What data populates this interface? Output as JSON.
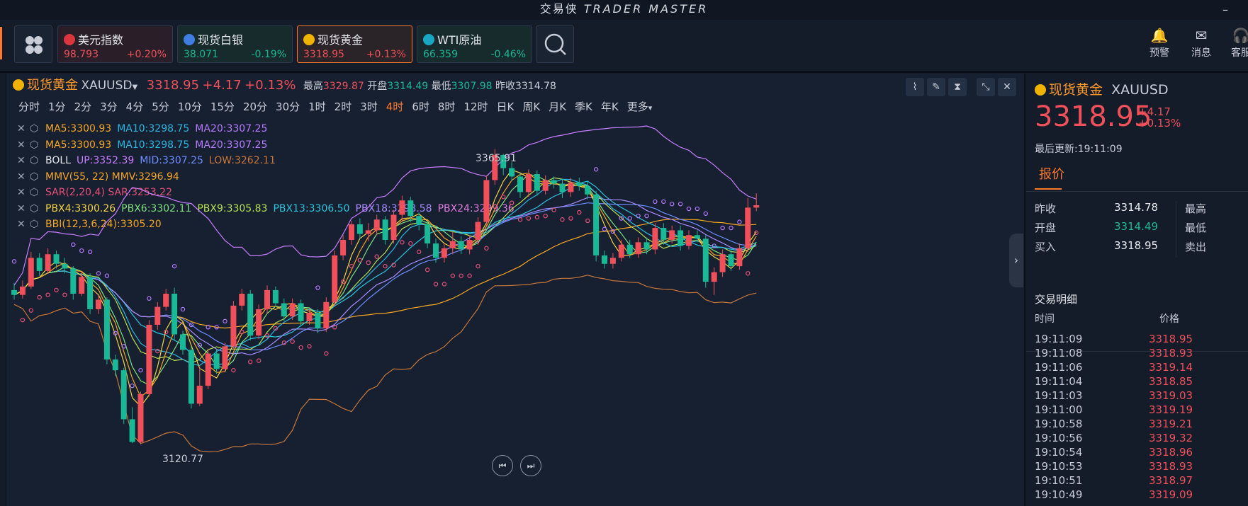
{
  "window": {
    "title_cn": "交易侠",
    "title_en": "TRADER MASTER",
    "minimize": "–"
  },
  "quotes": [
    {
      "name": "美元指数",
      "price": "98.793",
      "change": "+0.20%",
      "dir": "up",
      "icon_color": "#d9363e",
      "icon": "flag-icon"
    },
    {
      "name": "现货白银",
      "price": "38.071",
      "change": "-0.19%",
      "dir": "down",
      "icon_color": "#3d7ee0",
      "icon": "silver-icon"
    },
    {
      "name": "现货黄金",
      "price": "3318.95",
      "change": "+0.13%",
      "dir": "up",
      "icon_color": "#f0b400",
      "icon": "gold-icon"
    },
    {
      "name": "WTI原油",
      "price": "66.359",
      "change": "-0.46%",
      "dir": "down",
      "icon_color": "#19a7c4",
      "icon": "oil-icon"
    }
  ],
  "toolbar_right": [
    {
      "label": "预警",
      "icon": "bell-icon"
    },
    {
      "label": "消息",
      "icon": "mail-icon"
    },
    {
      "label": "客服",
      "icon": "headset-icon"
    }
  ],
  "symbol": {
    "name": "现货黄金",
    "code": "XAUUSD",
    "price": "3318.95",
    "change": "+4.17",
    "pct": "+0.13%",
    "high_label": "最高",
    "high": "3329.87",
    "open_label": "开盘",
    "open": "3314.49",
    "low_label": "最低",
    "low": "3307.98",
    "prev_label": "昨收",
    "prev": "3314.78"
  },
  "timeframes": [
    "分时",
    "1分",
    "2分",
    "3分",
    "4分",
    "5分",
    "10分",
    "15分",
    "20分",
    "30分",
    "1时",
    "2时",
    "3时",
    "4时",
    "6时",
    "8时",
    "12时",
    "日K",
    "周K",
    "月K",
    "季K",
    "年K",
    "更多"
  ],
  "active_timeframe": "4时",
  "indicators": [
    [
      {
        "t": "MA5:3300.93",
        "c": "#f5a623"
      },
      {
        "t": "MA10:3298.75",
        "c": "#29b6e0"
      },
      {
        "t": "MA20:3307.25",
        "c": "#b57bff"
      }
    ],
    [
      {
        "t": "MA5:3300.93",
        "c": "#f5a623"
      },
      {
        "t": "MA10:3298.75",
        "c": "#29b6e0"
      },
      {
        "t": "MA20:3307.25",
        "c": "#b57bff"
      }
    ],
    [
      {
        "t": "BOLL",
        "c": "#e6e8ed"
      },
      {
        "t": "UP:3352.39",
        "c": "#c77dff"
      },
      {
        "t": "MID:3307.25",
        "c": "#6f8dff"
      },
      {
        "t": "LOW:3262.11",
        "c": "#c7773a"
      }
    ],
    [
      {
        "t": "MMV(55, 22) MMV:3296.94",
        "c": "#f5a623"
      }
    ],
    [
      {
        "t": "SAR(2,20,4) SAR:3253.22",
        "c": "#e8507a"
      }
    ],
    [
      {
        "t": "PBX4:3300.26",
        "c": "#f5d442"
      },
      {
        "t": "PBX6:3302.11",
        "c": "#7de07d"
      },
      {
        "t": "PBX9:3305.83",
        "c": "#b6e052"
      },
      {
        "t": "PBX13:3306.50",
        "c": "#29c4e0"
      },
      {
        "t": "PBX18:3298.58",
        "c": "#a88bff"
      },
      {
        "t": "PBX24:3299.36",
        "c": "#e07de0"
      }
    ],
    [
      {
        "t": "BBI(12,3,6,24):3305.20",
        "c": "#f5a623"
      }
    ]
  ],
  "chart_annotations": {
    "high": "3365.91",
    "low": "3120.77"
  },
  "chart_data": {
    "type": "candlestick",
    "candles": [
      [
        3248,
        3244,
        3254,
        3240
      ],
      [
        3244,
        3251,
        3256,
        3241
      ],
      [
        3251,
        3275,
        3280,
        3249
      ],
      [
        3275,
        3264,
        3279,
        3260
      ],
      [
        3264,
        3278,
        3283,
        3262
      ],
      [
        3278,
        3270,
        3281,
        3266
      ],
      [
        3270,
        3266,
        3275,
        3262
      ],
      [
        3266,
        3245,
        3268,
        3240
      ],
      [
        3245,
        3259,
        3263,
        3243
      ],
      [
        3259,
        3232,
        3262,
        3228
      ],
      [
        3232,
        3240,
        3244,
        3228
      ],
      [
        3240,
        3190,
        3242,
        3186
      ],
      [
        3190,
        3181,
        3194,
        3176
      ],
      [
        3181,
        3140,
        3183,
        3136
      ],
      [
        3140,
        3121,
        3150,
        3120
      ],
      [
        3121,
        3161,
        3163,
        3119
      ],
      [
        3161,
        3219,
        3223,
        3159
      ],
      [
        3219,
        3234,
        3238,
        3215
      ],
      [
        3234,
        3245,
        3249,
        3231
      ],
      [
        3245,
        3211,
        3250,
        3206
      ],
      [
        3211,
        3198,
        3214,
        3194
      ],
      [
        3198,
        3153,
        3201,
        3149
      ],
      [
        3153,
        3168,
        3184,
        3151
      ],
      [
        3168,
        3195,
        3199,
        3165
      ],
      [
        3195,
        3182,
        3199,
        3178
      ],
      [
        3182,
        3201,
        3204,
        3180
      ],
      [
        3201,
        3235,
        3239,
        3199
      ],
      [
        3235,
        3245,
        3249,
        3231
      ],
      [
        3245,
        3210,
        3248,
        3206
      ],
      [
        3210,
        3232,
        3236,
        3207
      ],
      [
        3232,
        3248,
        3252,
        3228
      ],
      [
        3248,
        3237,
        3251,
        3234
      ],
      [
        3237,
        3226,
        3241,
        3222
      ],
      [
        3226,
        3237,
        3241,
        3223
      ],
      [
        3237,
        3222,
        3240,
        3218
      ],
      [
        3222,
        3229,
        3233,
        3219
      ],
      [
        3229,
        3216,
        3232,
        3212
      ],
      [
        3216,
        3238,
        3242,
        3213
      ],
      [
        3238,
        3277,
        3281,
        3235
      ],
      [
        3277,
        3290,
        3294,
        3273
      ],
      [
        3290,
        3303,
        3306,
        3286
      ],
      [
        3303,
        3295,
        3308,
        3291
      ],
      [
        3295,
        3298,
        3304,
        3289
      ],
      [
        3298,
        3307,
        3311,
        3294
      ],
      [
        3307,
        3290,
        3310,
        3286
      ],
      [
        3290,
        3311,
        3315,
        3287
      ],
      [
        3311,
        3323,
        3327,
        3306
      ],
      [
        3323,
        3310,
        3326,
        3305
      ],
      [
        3310,
        3303,
        3313,
        3298
      ],
      [
        3303,
        3287,
        3306,
        3283
      ],
      [
        3287,
        3275,
        3291,
        3271
      ],
      [
        3275,
        3283,
        3287,
        3271
      ],
      [
        3283,
        3289,
        3297,
        3278
      ],
      [
        3289,
        3282,
        3293,
        3278
      ],
      [
        3282,
        3290,
        3294,
        3278
      ],
      [
        3290,
        3305,
        3309,
        3286
      ],
      [
        3305,
        3340,
        3344,
        3301
      ],
      [
        3340,
        3361,
        3366,
        3336
      ],
      [
        3361,
        3350,
        3362,
        3344
      ],
      [
        3350,
        3343,
        3355,
        3339
      ],
      [
        3343,
        3330,
        3346,
        3325
      ],
      [
        3330,
        3345,
        3349,
        3326
      ],
      [
        3345,
        3331,
        3348,
        3327
      ],
      [
        3331,
        3340,
        3344,
        3328
      ],
      [
        3340,
        3337,
        3343,
        3333
      ],
      [
        3337,
        3330,
        3341,
        3325
      ],
      [
        3330,
        3338,
        3342,
        3326
      ],
      [
        3338,
        3335,
        3342,
        3331
      ],
      [
        3335,
        3328,
        3339,
        3324
      ],
      [
        3328,
        3277,
        3331,
        3272
      ],
      [
        3277,
        3270,
        3281,
        3266
      ],
      [
        3270,
        3275,
        3279,
        3266
      ],
      [
        3275,
        3286,
        3290,
        3272
      ],
      [
        3286,
        3278,
        3290,
        3275
      ],
      [
        3278,
        3288,
        3292,
        3275
      ],
      [
        3288,
        3282,
        3292,
        3278
      ],
      [
        3282,
        3300,
        3304,
        3278
      ],
      [
        3300,
        3290,
        3304,
        3286
      ],
      [
        3290,
        3298,
        3302,
        3287
      ],
      [
        3298,
        3285,
        3302,
        3281
      ],
      [
        3285,
        3294,
        3298,
        3282
      ],
      [
        3294,
        3291,
        3298,
        3288
      ],
      [
        3291,
        3255,
        3294,
        3250
      ],
      [
        3255,
        3263,
        3267,
        3244
      ],
      [
        3263,
        3278,
        3282,
        3259
      ],
      [
        3278,
        3268,
        3282,
        3264
      ],
      [
        3268,
        3283,
        3287,
        3265
      ],
      [
        3283,
        3317,
        3325,
        3280
      ],
      [
        3317,
        3319,
        3329,
        3314
      ]
    ],
    "ylim": [
      3100,
      3390
    ]
  },
  "right": {
    "name": "现货黄金",
    "code": "XAUUSD",
    "price": "3318.95",
    "change": "+4.17",
    "pct": "+0.13%",
    "update_label": "最后更新:",
    "update_time": "19:11:09",
    "tab": "报价",
    "stats": [
      {
        "label": "昨收",
        "value": "3314.78",
        "dir": "none",
        "label2": "最高"
      },
      {
        "label": "开盘",
        "value": "3314.49",
        "dir": "down",
        "label2": "最低"
      },
      {
        "label": "买入",
        "value": "3318.95",
        "dir": "none",
        "label2": "卖出"
      }
    ],
    "trade_title": "交易明细",
    "col_time": "时间",
    "col_price": "价格",
    "trades": [
      [
        "19:11:09",
        "3318.95"
      ],
      [
        "19:11:08",
        "3318.93"
      ],
      [
        "19:11:06",
        "3319.14"
      ],
      [
        "19:11:04",
        "3318.85"
      ],
      [
        "19:11:03",
        "3319.03"
      ],
      [
        "19:11:00",
        "3319.19"
      ],
      [
        "19:10:58",
        "3319.21"
      ],
      [
        "19:10:56",
        "3319.32"
      ],
      [
        "19:10:54",
        "3318.96"
      ],
      [
        "19:10:53",
        "3318.93"
      ],
      [
        "19:10:51",
        "3318.97"
      ],
      [
        "19:10:49",
        "3319.09"
      ]
    ]
  }
}
